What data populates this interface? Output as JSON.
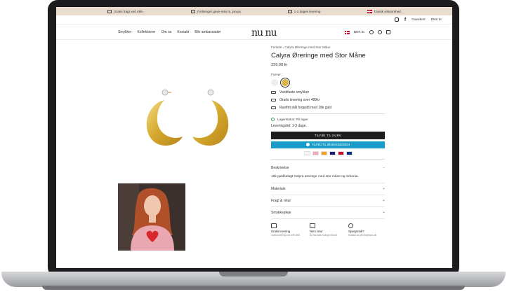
{
  "announcement": {
    "items": [
      {
        "icon": "box-icon",
        "text": "Gratis fragt ved 499,-"
      },
      {
        "icon": "gift-icon",
        "text": "Forlænget gave-retur 8. januar"
      },
      {
        "icon": "truck-icon",
        "text": "1-2 dages levering"
      },
      {
        "icon": "danish-flag-icon",
        "text": "Dansk virksomhed"
      }
    ]
  },
  "utility": {
    "giftcard": "Gavekort",
    "currency": "DKK kr."
  },
  "nav": {
    "logo": "nu nu",
    "links": [
      "Smykker",
      "Kollektioner",
      "Om os",
      "Kontakt",
      "Bliv ambassadør"
    ],
    "locale": "DKK kr."
  },
  "product": {
    "breadcrumb": "Forside › Calyra Øreringe med Stor Måne",
    "title": "Calyra Øreringe med Stor Måne",
    "price": "239,00 kr",
    "color_label": "Farver :",
    "features": [
      "Vandfaste smykker",
      "Gratis levering over 499kr",
      "Rustfrit stål forgyldt med 18k guld"
    ],
    "stock": "Lagerstatus: På lager",
    "delivery": "Leveringstid: 1-3 dage.",
    "add_to_cart": "TILFØJ TIL KURV",
    "wishlist": "TILFØJ TIL ØNSKESEDDEN",
    "accordions": {
      "description": {
        "label": "Beskrivelse",
        "toggle": "−",
        "text": "18k guldbelagt Calyra øreringe med stor måne og zirkonia."
      },
      "material": {
        "label": "Materiale",
        "toggle": "+"
      },
      "shipping": {
        "label": "Fragt & retur",
        "toggle": "+"
      },
      "care": {
        "label": "Smykkepleje",
        "toggle": "+"
      }
    },
    "perks": [
      {
        "title": "Gratis levering",
        "sub": "Gratis levering over 499 DKK"
      },
      {
        "title": "Nem retur",
        "sub": "Du har altid et langt returret"
      },
      {
        "title": "Spørgsmål?",
        "sub": "Kontakt os på info@nunu.dk"
      }
    ]
  },
  "colors": {
    "topbar": "#e7dccd",
    "cart_button": "#1e1e1e",
    "wishlist_button": "#1a9cc9",
    "gold": "#d8b44a"
  }
}
